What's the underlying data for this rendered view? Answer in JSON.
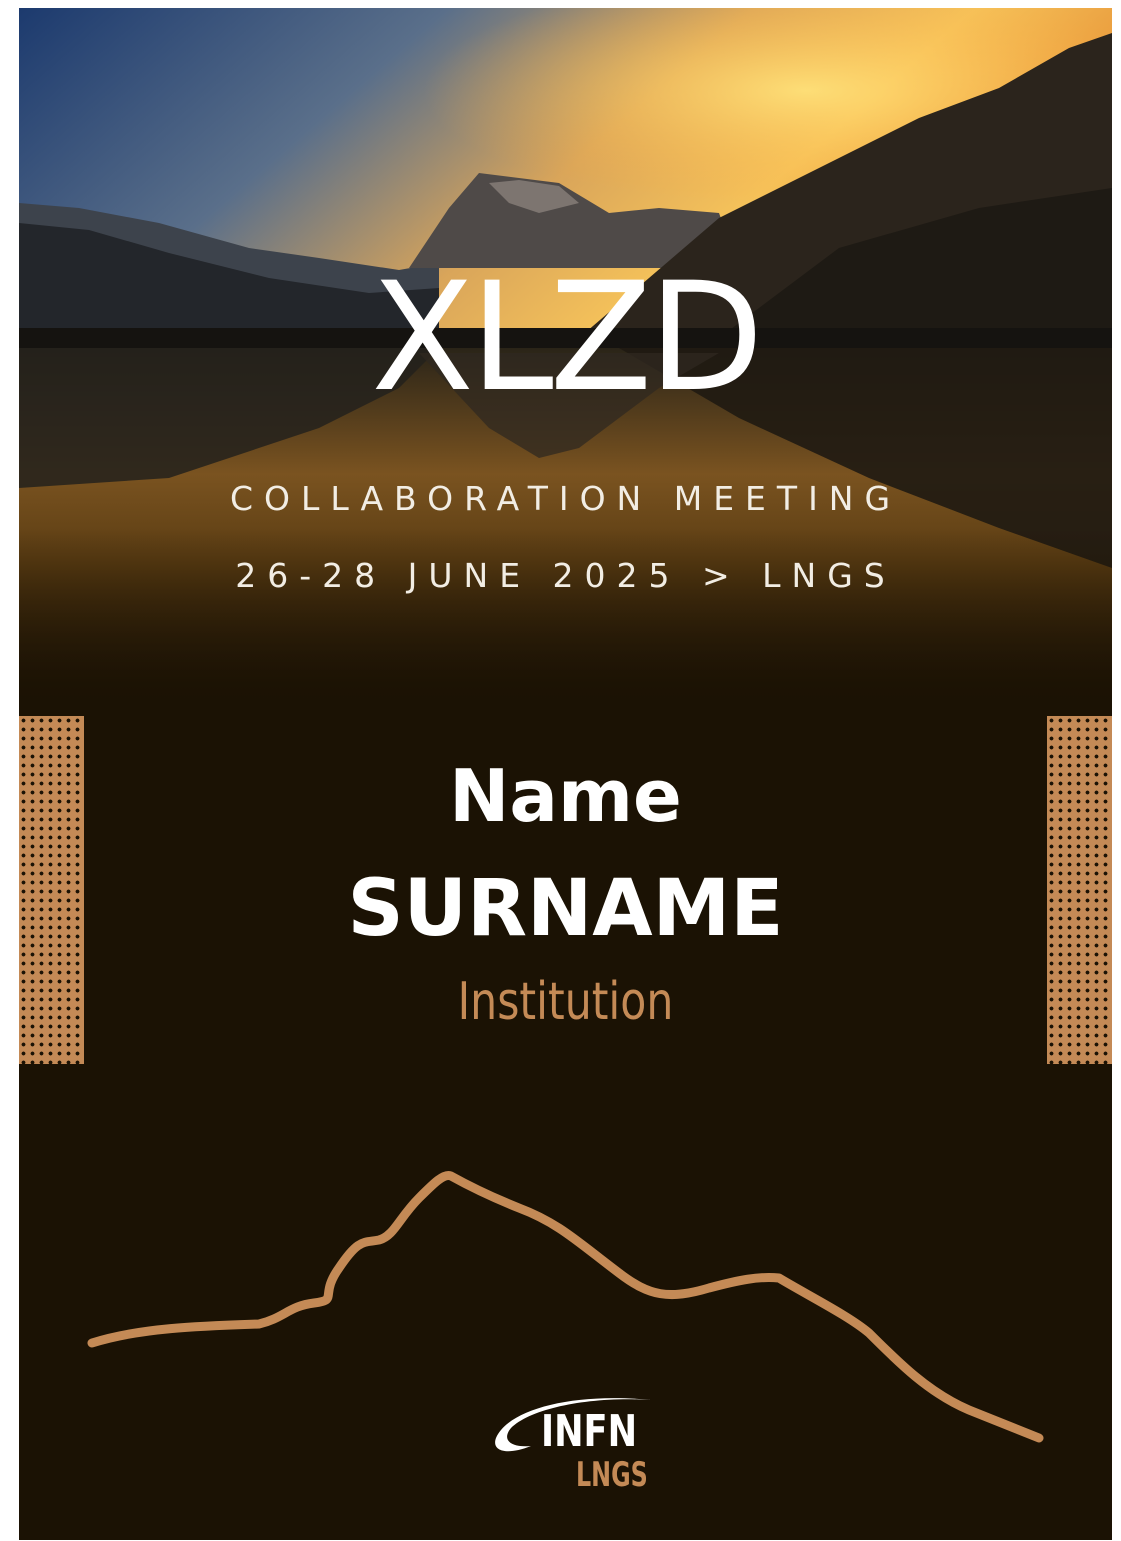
{
  "event": {
    "title": "XLZD",
    "subtitle": "COLLABORATION MEETING",
    "dates_location": "26-28 JUNE 2025 > LNGS"
  },
  "attendee": {
    "first_name": "Name",
    "last_name": "SURNAME",
    "institution": "Institution"
  },
  "logo": {
    "main": "INFN",
    "sub": "LNGS"
  },
  "colors": {
    "background": "#1b1204",
    "accent": "#c48a56",
    "text": "#ffffff"
  }
}
